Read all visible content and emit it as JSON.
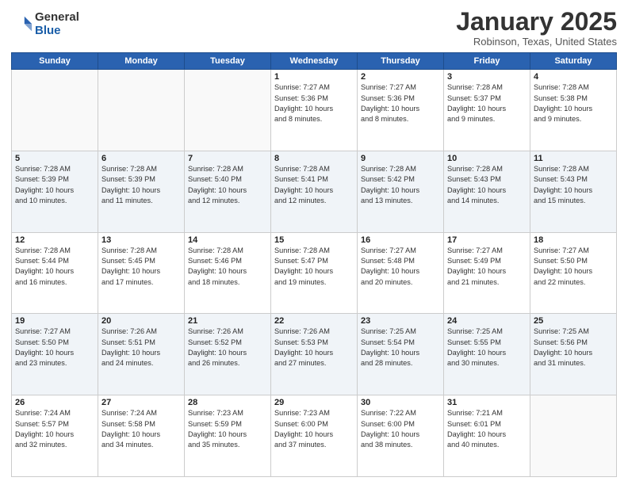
{
  "header": {
    "logo_general": "General",
    "logo_blue": "Blue",
    "month_title": "January 2025",
    "location": "Robinson, Texas, United States"
  },
  "days_of_week": [
    "Sunday",
    "Monday",
    "Tuesday",
    "Wednesday",
    "Thursday",
    "Friday",
    "Saturday"
  ],
  "weeks": [
    [
      {
        "day": "",
        "info": ""
      },
      {
        "day": "",
        "info": ""
      },
      {
        "day": "",
        "info": ""
      },
      {
        "day": "1",
        "info": "Sunrise: 7:27 AM\nSunset: 5:36 PM\nDaylight: 10 hours\nand 8 minutes."
      },
      {
        "day": "2",
        "info": "Sunrise: 7:27 AM\nSunset: 5:36 PM\nDaylight: 10 hours\nand 8 minutes."
      },
      {
        "day": "3",
        "info": "Sunrise: 7:28 AM\nSunset: 5:37 PM\nDaylight: 10 hours\nand 9 minutes."
      },
      {
        "day": "4",
        "info": "Sunrise: 7:28 AM\nSunset: 5:38 PM\nDaylight: 10 hours\nand 9 minutes."
      }
    ],
    [
      {
        "day": "5",
        "info": "Sunrise: 7:28 AM\nSunset: 5:39 PM\nDaylight: 10 hours\nand 10 minutes."
      },
      {
        "day": "6",
        "info": "Sunrise: 7:28 AM\nSunset: 5:39 PM\nDaylight: 10 hours\nand 11 minutes."
      },
      {
        "day": "7",
        "info": "Sunrise: 7:28 AM\nSunset: 5:40 PM\nDaylight: 10 hours\nand 12 minutes."
      },
      {
        "day": "8",
        "info": "Sunrise: 7:28 AM\nSunset: 5:41 PM\nDaylight: 10 hours\nand 12 minutes."
      },
      {
        "day": "9",
        "info": "Sunrise: 7:28 AM\nSunset: 5:42 PM\nDaylight: 10 hours\nand 13 minutes."
      },
      {
        "day": "10",
        "info": "Sunrise: 7:28 AM\nSunset: 5:43 PM\nDaylight: 10 hours\nand 14 minutes."
      },
      {
        "day": "11",
        "info": "Sunrise: 7:28 AM\nSunset: 5:43 PM\nDaylight: 10 hours\nand 15 minutes."
      }
    ],
    [
      {
        "day": "12",
        "info": "Sunrise: 7:28 AM\nSunset: 5:44 PM\nDaylight: 10 hours\nand 16 minutes."
      },
      {
        "day": "13",
        "info": "Sunrise: 7:28 AM\nSunset: 5:45 PM\nDaylight: 10 hours\nand 17 minutes."
      },
      {
        "day": "14",
        "info": "Sunrise: 7:28 AM\nSunset: 5:46 PM\nDaylight: 10 hours\nand 18 minutes."
      },
      {
        "day": "15",
        "info": "Sunrise: 7:28 AM\nSunset: 5:47 PM\nDaylight: 10 hours\nand 19 minutes."
      },
      {
        "day": "16",
        "info": "Sunrise: 7:27 AM\nSunset: 5:48 PM\nDaylight: 10 hours\nand 20 minutes."
      },
      {
        "day": "17",
        "info": "Sunrise: 7:27 AM\nSunset: 5:49 PM\nDaylight: 10 hours\nand 21 minutes."
      },
      {
        "day": "18",
        "info": "Sunrise: 7:27 AM\nSunset: 5:50 PM\nDaylight: 10 hours\nand 22 minutes."
      }
    ],
    [
      {
        "day": "19",
        "info": "Sunrise: 7:27 AM\nSunset: 5:50 PM\nDaylight: 10 hours\nand 23 minutes."
      },
      {
        "day": "20",
        "info": "Sunrise: 7:26 AM\nSunset: 5:51 PM\nDaylight: 10 hours\nand 24 minutes."
      },
      {
        "day": "21",
        "info": "Sunrise: 7:26 AM\nSunset: 5:52 PM\nDaylight: 10 hours\nand 26 minutes."
      },
      {
        "day": "22",
        "info": "Sunrise: 7:26 AM\nSunset: 5:53 PM\nDaylight: 10 hours\nand 27 minutes."
      },
      {
        "day": "23",
        "info": "Sunrise: 7:25 AM\nSunset: 5:54 PM\nDaylight: 10 hours\nand 28 minutes."
      },
      {
        "day": "24",
        "info": "Sunrise: 7:25 AM\nSunset: 5:55 PM\nDaylight: 10 hours\nand 30 minutes."
      },
      {
        "day": "25",
        "info": "Sunrise: 7:25 AM\nSunset: 5:56 PM\nDaylight: 10 hours\nand 31 minutes."
      }
    ],
    [
      {
        "day": "26",
        "info": "Sunrise: 7:24 AM\nSunset: 5:57 PM\nDaylight: 10 hours\nand 32 minutes."
      },
      {
        "day": "27",
        "info": "Sunrise: 7:24 AM\nSunset: 5:58 PM\nDaylight: 10 hours\nand 34 minutes."
      },
      {
        "day": "28",
        "info": "Sunrise: 7:23 AM\nSunset: 5:59 PM\nDaylight: 10 hours\nand 35 minutes."
      },
      {
        "day": "29",
        "info": "Sunrise: 7:23 AM\nSunset: 6:00 PM\nDaylight: 10 hours\nand 37 minutes."
      },
      {
        "day": "30",
        "info": "Sunrise: 7:22 AM\nSunset: 6:00 PM\nDaylight: 10 hours\nand 38 minutes."
      },
      {
        "day": "31",
        "info": "Sunrise: 7:21 AM\nSunset: 6:01 PM\nDaylight: 10 hours\nand 40 minutes."
      },
      {
        "day": "",
        "info": ""
      }
    ]
  ]
}
